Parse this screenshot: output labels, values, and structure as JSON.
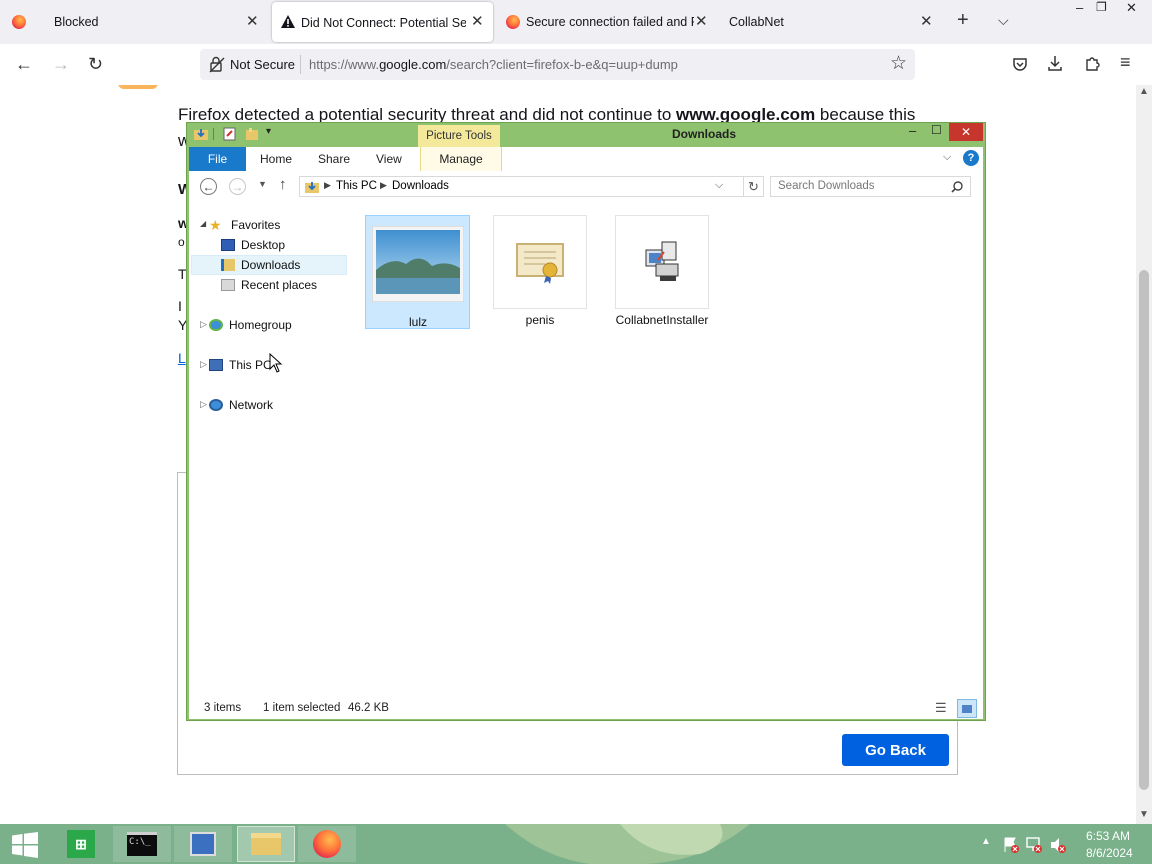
{
  "browser": {
    "tabs": [
      {
        "title": "Blocked"
      },
      {
        "title": "Did Not Connect: Potential Securit"
      },
      {
        "title": "Secure connection failed and Firefo"
      },
      {
        "title": "CollabNet"
      }
    ],
    "nav": {
      "security_label": "Not Secure",
      "url_prefix": "https://www.",
      "url_host": "google.com",
      "url_path": "/search?client=firefox-b-e&q=uup+dump"
    }
  },
  "page": {
    "text_before": "Firefox detected a potential security threat and did not continue to ",
    "text_host": "www.google.com",
    "text_after": " because this",
    "line2_start": "w",
    "frag_w": "W",
    "frag_w2": "w",
    "frag_o": "o",
    "frag_t": "T",
    "frag_i": "I",
    "frag_y": "Y",
    "frag_l": "L",
    "go_back": "Go Back"
  },
  "explorer": {
    "title": "Downloads",
    "picture_tools": "Picture Tools",
    "ribbon_tabs": [
      "File",
      "Home",
      "Share",
      "View",
      "Manage"
    ],
    "breadcrumb": [
      "This PC",
      "Downloads"
    ],
    "search_placeholder": "Search Downloads",
    "nav": {
      "favorites": "Favorites",
      "desktop": "Desktop",
      "downloads": "Downloads",
      "recent": "Recent places",
      "homegroup": "Homegroup",
      "thispc": "This PC",
      "network": "Network"
    },
    "files": [
      {
        "name": "lulz",
        "icon": "landscape-image-icon",
        "selected": true
      },
      {
        "name": "penis",
        "icon": "certificate-icon",
        "selected": false
      },
      {
        "name": "CollabnetInstaller",
        "icon": "installer-icon",
        "selected": false
      }
    ],
    "status": {
      "items": "3 items",
      "selected": "1 item selected",
      "size": "46.2 KB"
    }
  },
  "taskbar": {
    "time": "6:53 AM",
    "date": "8/6/2024",
    "apps": [
      "store-icon",
      "command-prompt-icon",
      "control-panel-icon",
      "file-explorer-icon",
      "firefox-icon"
    ]
  },
  "colors": {
    "explorer_frame": "#8fc26f",
    "file_tab": "#1979ca",
    "picture_tools": "#f4e99a",
    "go_back": "#0061e0",
    "taskbar": "#7ab08a"
  }
}
